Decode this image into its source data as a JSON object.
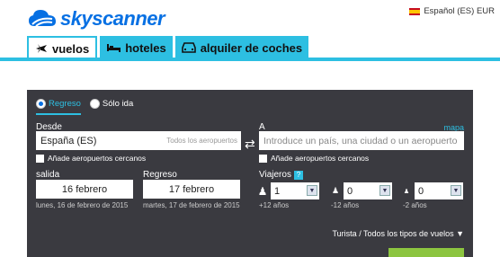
{
  "brand": {
    "name": "skyscanner",
    "color": "#0770e3"
  },
  "locale": {
    "label": "Español (ES) EUR",
    "flag": "spain-flag"
  },
  "tabs": [
    {
      "label": "vuelos",
      "icon": "plane-icon",
      "active": true
    },
    {
      "label": "hoteles",
      "icon": "bed-icon",
      "active": false
    },
    {
      "label": "alquiler de coches",
      "icon": "car-icon",
      "active": false
    }
  ],
  "trip_type": {
    "options": [
      "Regreso",
      "Sólo ida"
    ],
    "selected": "Regreso"
  },
  "from": {
    "label": "Desde",
    "value": "España (ES)",
    "hint": "Todos los aeropuertos",
    "nearby": "Añade aeropuertos cercanos"
  },
  "to": {
    "label": "A",
    "placeholder": "Introduce un país, una ciudad o un aeropuerto",
    "map_link": "mapa",
    "nearby": "Añade aeropuertos cercanos"
  },
  "departure": {
    "label": "salida",
    "value": "16 febrero",
    "detail": "lunes, 16 de febrero de 2015"
  },
  "return": {
    "label": "Regreso",
    "value": "17 febrero",
    "detail": "martes, 17 de febrero de 2015"
  },
  "travellers": {
    "label": "Viajeros",
    "help": "?",
    "groups": [
      {
        "value": "1",
        "age": "+12 años",
        "icon": "adult-icon"
      },
      {
        "value": "0",
        "age": "-12 años",
        "icon": "child-icon"
      },
      {
        "value": "0",
        "age": "-2 años",
        "icon": "infant-icon"
      }
    ]
  },
  "cabin": {
    "label": "Turista / Todos los tipos de vuelos ▼"
  },
  "colors": {
    "accent": "#2dbfe2",
    "panel": "#3a3a40",
    "search": "#8cc540"
  }
}
